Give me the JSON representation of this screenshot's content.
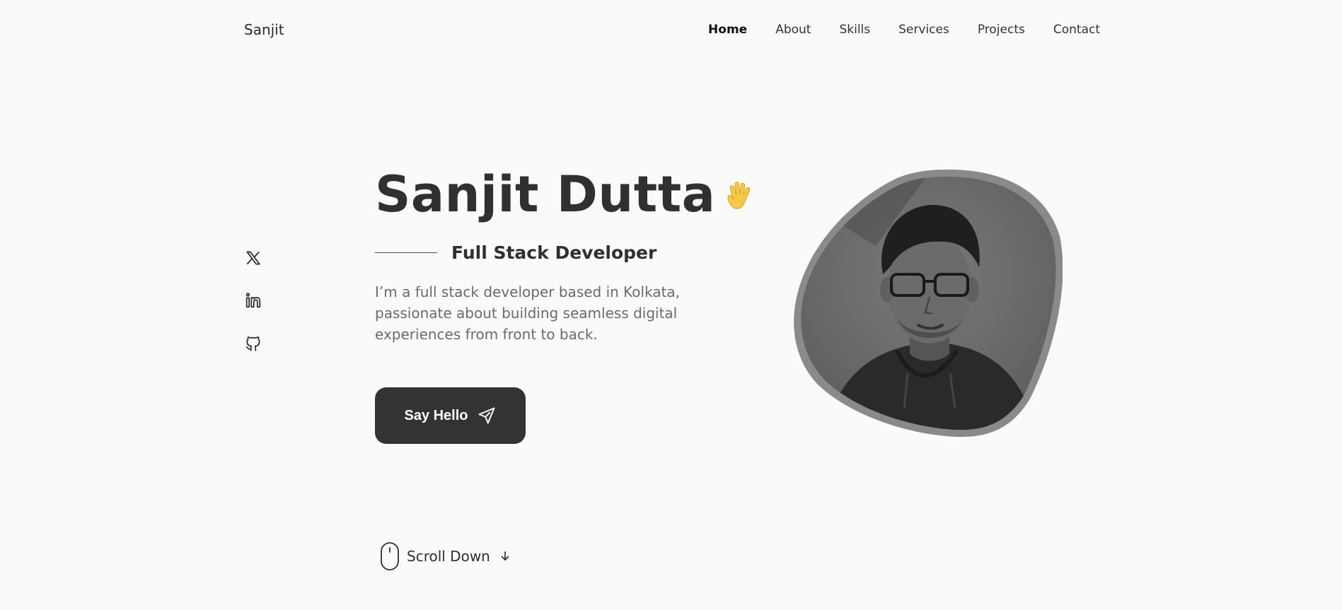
{
  "header": {
    "logo": "Sanjit",
    "nav": [
      {
        "label": "Home",
        "active": true
      },
      {
        "label": "About",
        "active": false
      },
      {
        "label": "Skills",
        "active": false
      },
      {
        "label": "Services",
        "active": false
      },
      {
        "label": "Projects",
        "active": false
      },
      {
        "label": "Contact",
        "active": false
      }
    ]
  },
  "social": {
    "icons": [
      "x-icon",
      "linkedin-icon",
      "github-icon"
    ]
  },
  "hero": {
    "name": "Sanjit Dutta",
    "wave_icon": "waving-hand-icon",
    "subtitle": "Full Stack Developer",
    "description": "I’m a full stack developer based in Kolkata, passionate about building seamless digital experiences from front to back.",
    "cta_label": "Say Hello",
    "cta_icon": "send-icon",
    "scroll_label": "Scroll Down"
  },
  "colors": {
    "background": "#fafafa",
    "text": "#333333",
    "muted": "#6b6b6b",
    "button": "#333333",
    "wave": "#f7c948"
  }
}
